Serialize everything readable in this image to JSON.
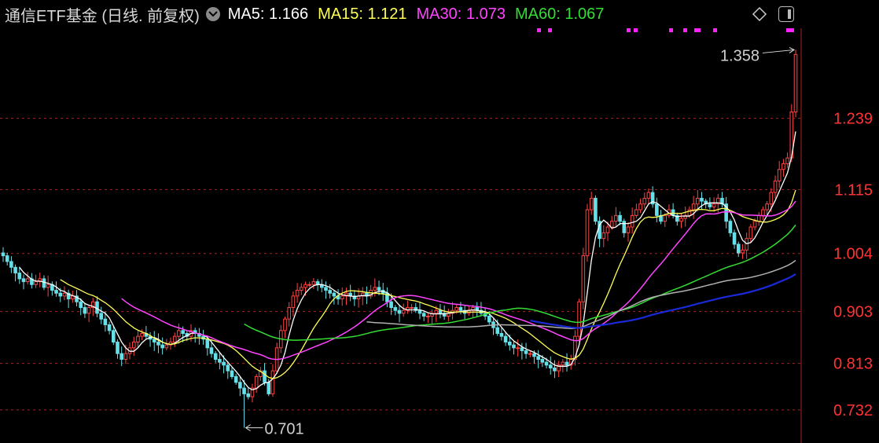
{
  "header": {
    "title": "通信ETF基金 (日线. 前复权)",
    "ma5": {
      "label": "MA5:",
      "value": "1.166",
      "color": "#ffffff"
    },
    "ma15": {
      "label": "MA15:",
      "value": "1.121",
      "color": "#ffff55"
    },
    "ma30": {
      "label": "MA30:",
      "value": "1.073",
      "color": "#ff44ff"
    },
    "ma60": {
      "label": "MA60:",
      "value": "1.067",
      "color": "#33dd33"
    }
  },
  "chart_data": {
    "type": "candlestick",
    "y_ticks": [
      "1.239",
      "1.115",
      "1.004",
      "0.903",
      "0.813",
      "0.732"
    ],
    "ylim": [
      0.68,
      1.39
    ],
    "high_marker": {
      "label": "1.358",
      "value": 1.358
    },
    "low_marker": {
      "label": "0.701",
      "value": 0.701
    },
    "colors": {
      "up": "#ff4444",
      "down": "#66e0e8",
      "grid": "#aa2222",
      "axis_text": "#ff3333",
      "ma120": "#b0b0b0",
      "ma250": "#1a2ad8"
    },
    "close": [
      1.0,
      0.99,
      0.98,
      0.97,
      0.96,
      0.955,
      0.96,
      0.95,
      0.955,
      0.96,
      0.945,
      0.95,
      0.94,
      0.935,
      0.93,
      0.935,
      0.925,
      0.93,
      0.92,
      0.91,
      0.9,
      0.91,
      0.92,
      0.9,
      0.89,
      0.88,
      0.87,
      0.85,
      0.83,
      0.82,
      0.83,
      0.84,
      0.85,
      0.86,
      0.865,
      0.86,
      0.855,
      0.85,
      0.845,
      0.84,
      0.845,
      0.85,
      0.86,
      0.87,
      0.865,
      0.86,
      0.87,
      0.865,
      0.86,
      0.855,
      0.84,
      0.83,
      0.82,
      0.815,
      0.81,
      0.8,
      0.79,
      0.78,
      0.77,
      0.76,
      0.755,
      0.77,
      0.79,
      0.8,
      0.78,
      0.76,
      0.8,
      0.84,
      0.87,
      0.89,
      0.91,
      0.93,
      0.94,
      0.945,
      0.95,
      0.95,
      0.955,
      0.95,
      0.945,
      0.94,
      0.935,
      0.93,
      0.925,
      0.93,
      0.935,
      0.93,
      0.925,
      0.93,
      0.935,
      0.93,
      0.94,
      0.945,
      0.94,
      0.935,
      0.92,
      0.91,
      0.905,
      0.9,
      0.905,
      0.91,
      0.91,
      0.905,
      0.9,
      0.895,
      0.895,
      0.9,
      0.905,
      0.9,
      0.895,
      0.9,
      0.905,
      0.91,
      0.905,
      0.9,
      0.905,
      0.91,
      0.905,
      0.9,
      0.895,
      0.885,
      0.875,
      0.865,
      0.86,
      0.85,
      0.845,
      0.84,
      0.84,
      0.835,
      0.83,
      0.83,
      0.825,
      0.82,
      0.815,
      0.81,
      0.805,
      0.8,
      0.81,
      0.815,
      0.81,
      0.82,
      0.86,
      0.92,
      1.0,
      1.08,
      1.1,
      1.06,
      1.03,
      1.04,
      1.05,
      1.06,
      1.07,
      1.06,
      1.04,
      1.05,
      1.07,
      1.08,
      1.09,
      1.1,
      1.11,
      1.09,
      1.07,
      1.06,
      1.07,
      1.08,
      1.07,
      1.06,
      1.065,
      1.07,
      1.08,
      1.09,
      1.1,
      1.095,
      1.09,
      1.085,
      1.09,
      1.1,
      1.09,
      1.06,
      1.04,
      1.02,
      1.005,
      1.01,
      1.03,
      1.05,
      1.06,
      1.07,
      1.08,
      1.09,
      1.11,
      1.13,
      1.15,
      1.16,
      1.17,
      1.25,
      1.35
    ]
  }
}
